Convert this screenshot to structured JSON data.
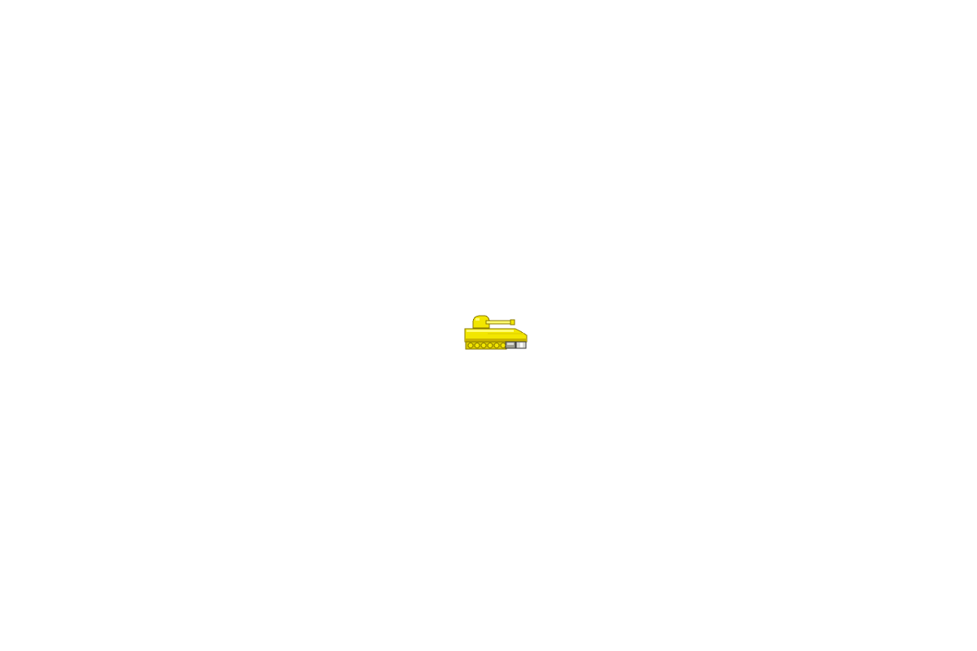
{
  "scene": {
    "background_color": "#ffffff",
    "sprites": [
      {
        "icon": "tank-sprite",
        "colors": {
          "body": "#f2e600",
          "highlight": "#fffb70",
          "shadow": "#c8b400",
          "outline": "#8a7a00",
          "treads_dark": "#9b9b8f",
          "treads_light": "#d7d7d2"
        }
      }
    ]
  }
}
